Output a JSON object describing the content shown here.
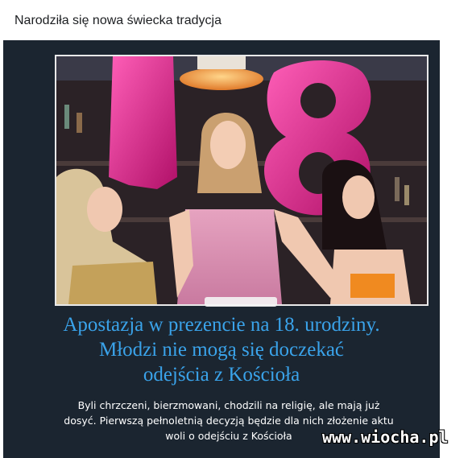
{
  "post": {
    "text": "Narodziła się nowa świecka tradycja"
  },
  "image": {
    "headline_lines": [
      "Apostazja w prezencie na 18. urodziny.",
      "Młodzi nie mogą się doczekać",
      "odejścia z Kościoła"
    ],
    "body_lines": [
      "Byli chrzczeni, bierzmowani, chodzili na religię, ale mają już",
      "dosyć. Pierwszą pełnoletnią decyzją będzie dla nich złożenie aktu",
      "woli o odejściu z Kościoła"
    ],
    "balloon_number": "18",
    "watermark": "www.wiocha.pl"
  },
  "colors": {
    "headline": "#3aa3ea",
    "balloon": "#e0218a",
    "background": "#1b2530"
  }
}
